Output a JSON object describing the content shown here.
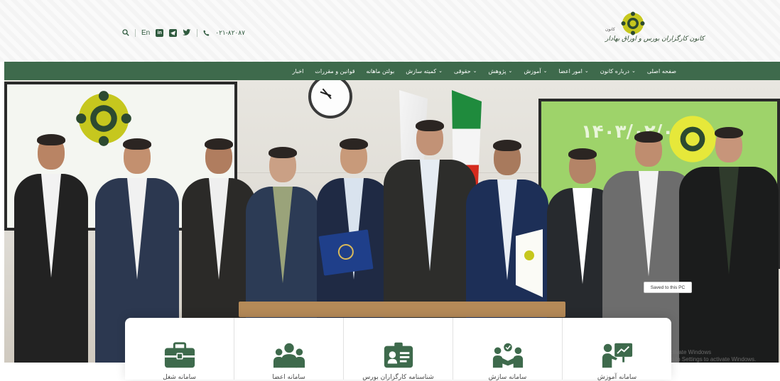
{
  "header": {
    "lang_label": "En",
    "phone": "۰۲۱-۸۲۰۸۷",
    "tools": {
      "search_icon": "search-icon",
      "linkedin": "in",
      "telegram_icon": "telegram-icon",
      "twitter_icon": "twitter-icon",
      "phone_icon": "phone-icon"
    },
    "logo": {
      "title": "کانون کارگزاران بورس و اوراق بهادار",
      "subtitle": "کانون"
    }
  },
  "nav": {
    "items": [
      {
        "label": "صفحه اصلی",
        "dropdown": false
      },
      {
        "label": "درباره کانون",
        "dropdown": true
      },
      {
        "label": "امور اعضا",
        "dropdown": true
      },
      {
        "label": "آموزش",
        "dropdown": true
      },
      {
        "label": "پژوهش",
        "dropdown": true
      },
      {
        "label": "حقوقی",
        "dropdown": true
      },
      {
        "label": "کمیته سازش",
        "dropdown": true
      },
      {
        "label": "بولتن ماهانه",
        "dropdown": false
      },
      {
        "label": "قوانین و مقررات",
        "dropdown": false
      },
      {
        "label": "اخبار",
        "dropdown": false
      }
    ],
    "chevron": "⌄"
  },
  "hero": {
    "screen_text": "۱۴۰۳/۰۲/۰۲",
    "toast": "Saved to this PC",
    "watermark_line1": "Activate Windows",
    "watermark_line2": "Go to Settings to activate Windows."
  },
  "cards": [
    {
      "label": "سامانه شغل",
      "icon": "briefcase-icon"
    },
    {
      "label": "سامانه اعضا",
      "icon": "users-icon"
    },
    {
      "label": "شناسنامه کارگزاران بورس",
      "icon": "id-card-icon"
    },
    {
      "label": "سامانه سازش",
      "icon": "handshake-icon"
    },
    {
      "label": "سامانه آموزش",
      "icon": "presentation-icon"
    }
  ],
  "colors": {
    "brand_green": "#3e6a4c",
    "logo_yellow": "#c6c71e",
    "icon_green": "#3e6a4c"
  }
}
